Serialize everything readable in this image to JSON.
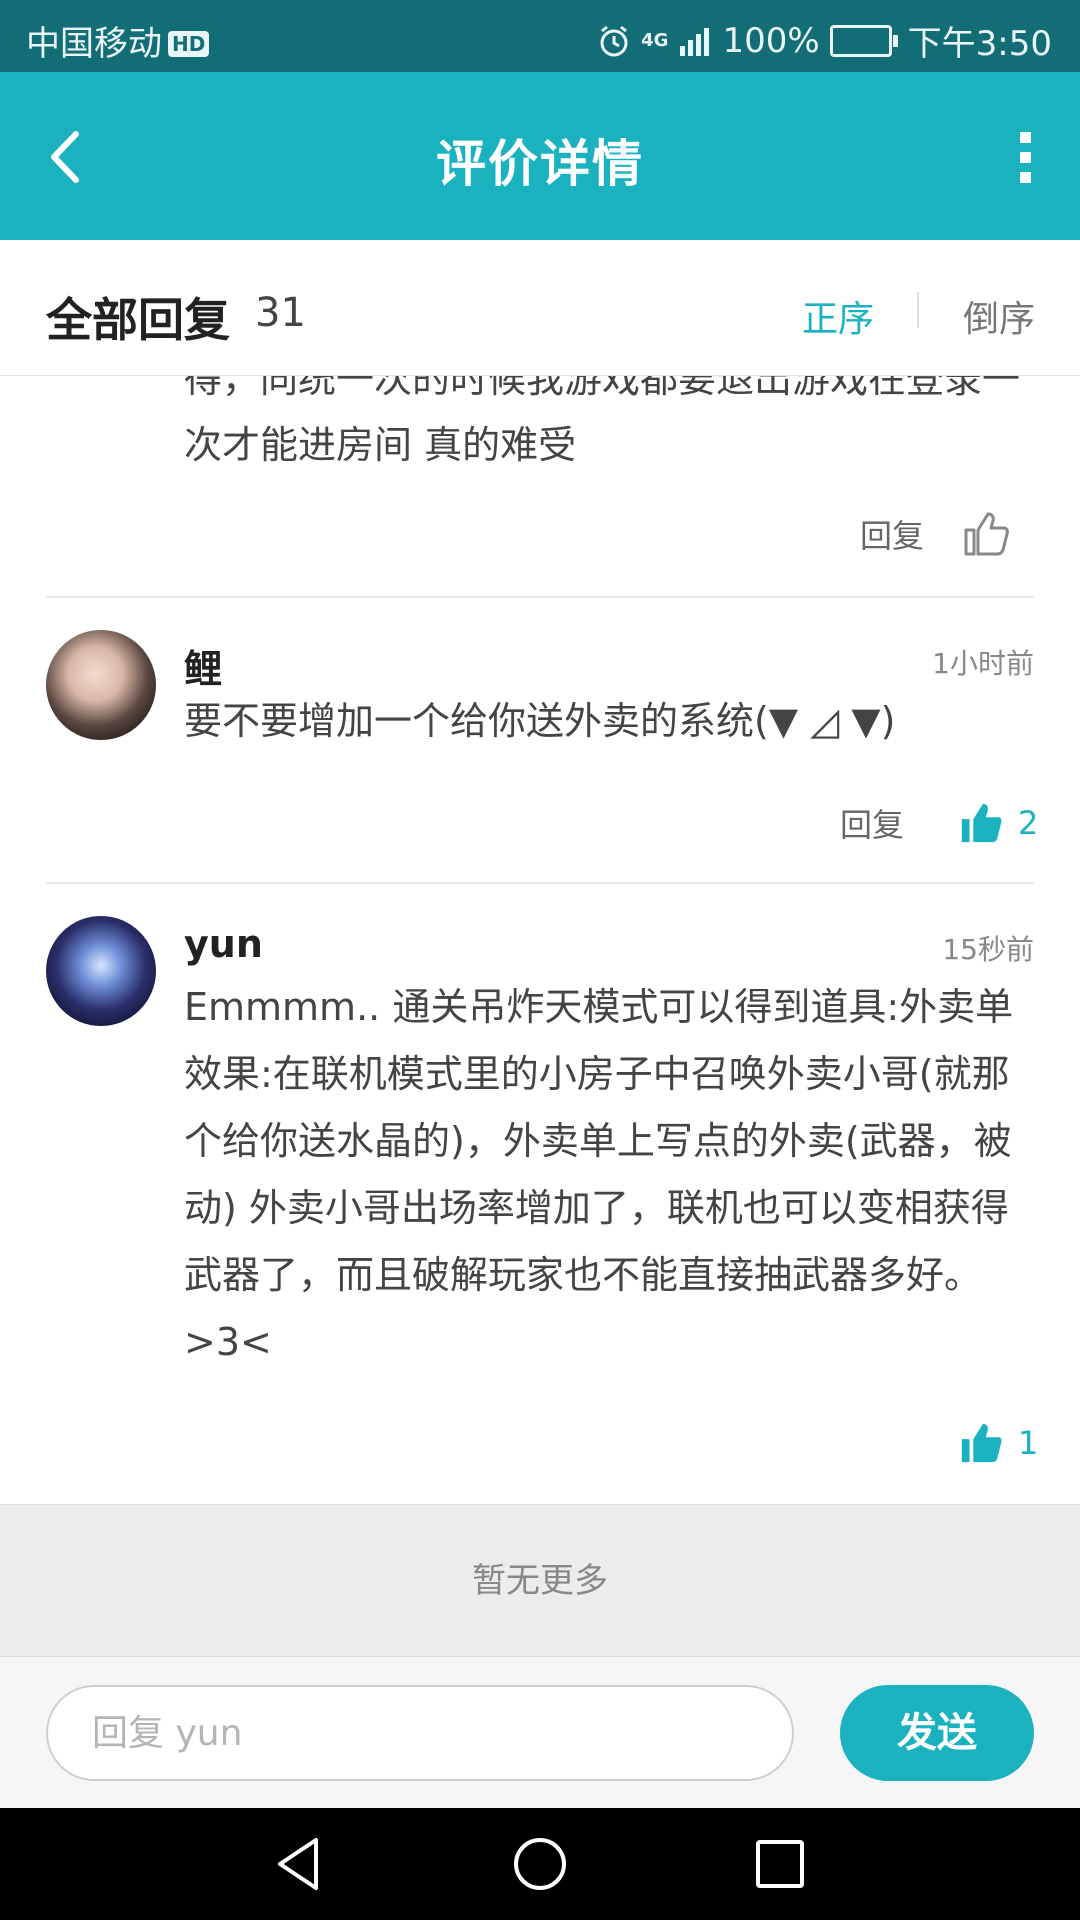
{
  "status_bar": {
    "carrier": "中国移动",
    "hd_badge": "HD",
    "network": "4G",
    "battery_text": "100%",
    "time": "下午3:50"
  },
  "app_bar": {
    "title": "评价详情",
    "back_icon": "chevron-left-icon",
    "more_icon": "more-vertical-icon"
  },
  "header": {
    "title": "全部回复",
    "count": "31",
    "sort_asc": "正序",
    "sort_desc": "倒序"
  },
  "comments": [
    {
      "partial": true,
      "text": "得，同统一次的时候我游戏都要退出游戏在登录一次才能进房间 真的难受",
      "reply_label": "回复",
      "liked": false,
      "likes": ""
    },
    {
      "username": "鲤",
      "time": "1小时前",
      "text": "要不要增加一个给你送外卖的系统(▼ ◿ ▼)",
      "reply_label": "回复",
      "liked": true,
      "likes": "2"
    },
    {
      "username": "yun",
      "time": "15秒前",
      "text": "Emmmm.. 通关吊炸天模式可以得到道具:外卖单 效果:在联机模式里的小房子中召唤外卖小哥(就那个给你送水晶的)，外卖单上写点的外卖(武器，被动) 外卖小哥出场率增加了，联机也可以变相获得武器了，而且破解玩家也不能直接抽武器多好。>3<",
      "liked": true,
      "likes": "1"
    }
  ],
  "footer": {
    "no_more": "暂无更多",
    "input_placeholder": "回复 yun",
    "send_label": "发送"
  },
  "colors": {
    "accent": "#1bb2c0",
    "status_bar": "#136d77"
  }
}
